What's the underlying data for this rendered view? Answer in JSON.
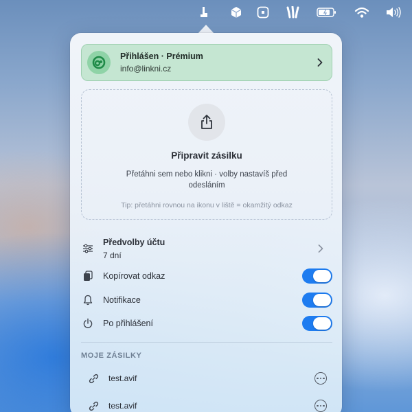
{
  "menubar": {
    "icons": [
      "linkni-app-icon",
      "box-icon",
      "square-app-icon",
      "carrot-icon",
      "battery-icon",
      "wifi-icon",
      "volume-icon"
    ]
  },
  "account": {
    "title": "Přihlášen · Prémium",
    "email": "info@linkni.cz",
    "accent": "#c5e6d2"
  },
  "dropzone": {
    "title": "Připravit zásilku",
    "description": "Přetáhni sem nebo klikni · volby nastavíš před odesláním",
    "tip": "Tip: přetáhni rovnou na ikonu v liště = okamžitý odkaz"
  },
  "preferences": {
    "title": "Předvolby účtu",
    "subtitle": "7 dní"
  },
  "toggles": [
    {
      "label": "Kopírovat odkaz",
      "on": true
    },
    {
      "label": "Notifikace",
      "on": true
    },
    {
      "label": "Po přihlášení",
      "on": true
    }
  ],
  "shipments": {
    "header": "MOJE ZÁSILKY",
    "items": [
      {
        "name": "test.avif"
      },
      {
        "name": "test.avif"
      }
    ]
  },
  "colors": {
    "toggle_on": "#1e7cf0",
    "account_bg": "#c5e6d2"
  }
}
